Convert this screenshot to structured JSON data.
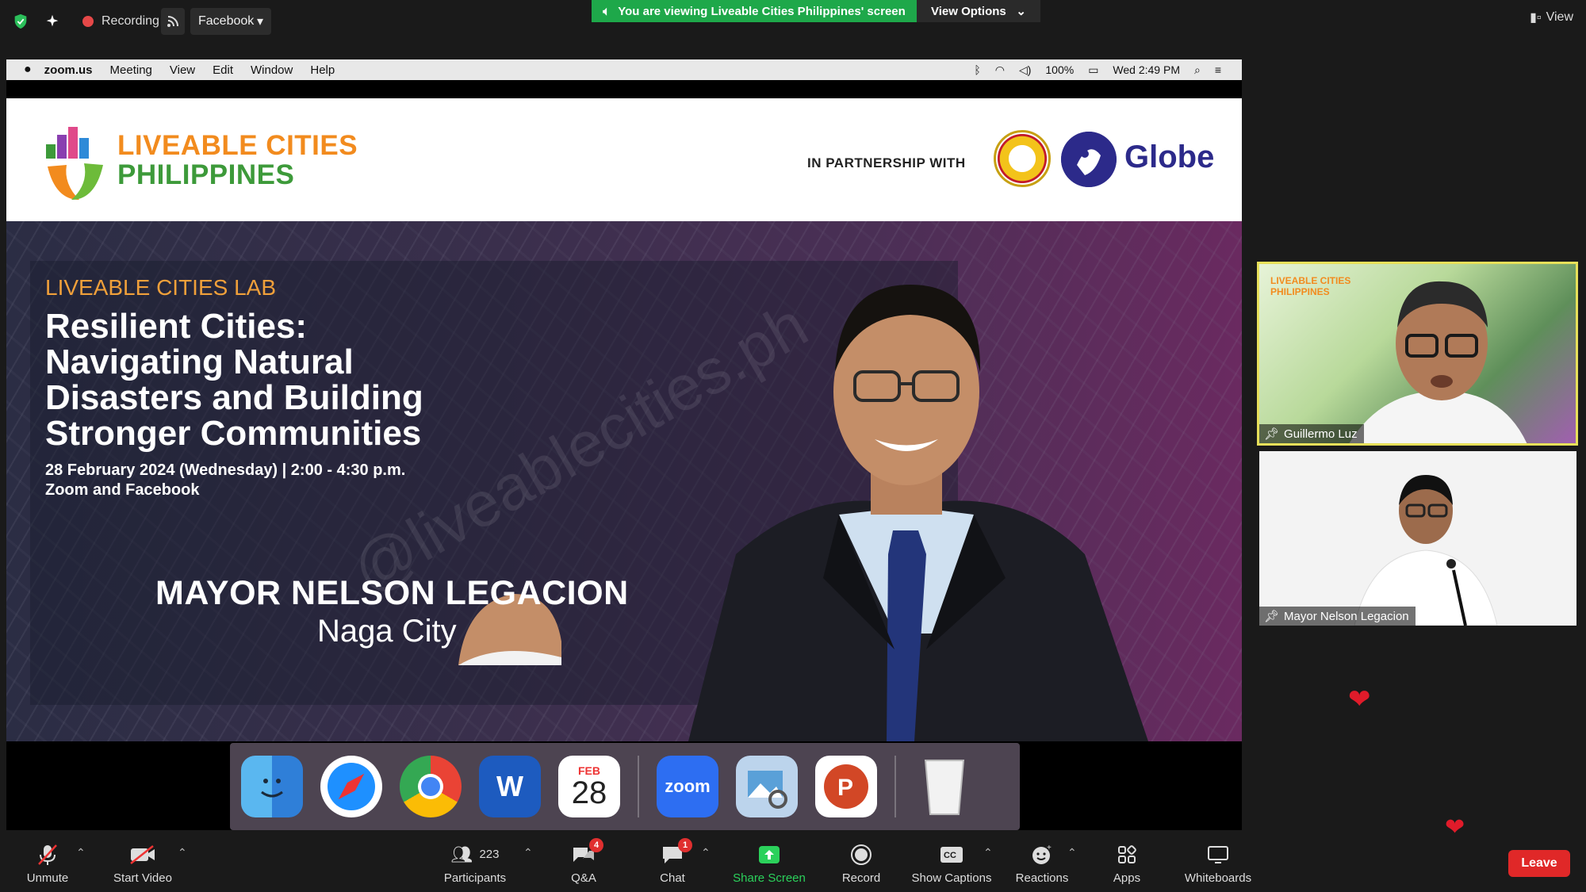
{
  "topbar": {
    "recording_label": "Recording",
    "stream_dropdown": "Facebook",
    "viewing_banner": "You are viewing Liveable Cities Philippines' screen",
    "view_options": "View Options",
    "view_label": "View"
  },
  "mac_menubar": {
    "app": "zoom.us",
    "menus": [
      "Meeting",
      "View",
      "Edit",
      "Window",
      "Help"
    ],
    "battery": "100%",
    "clock": "Wed 2:49 PM"
  },
  "slide": {
    "brand_line1": "LIVEABLE CITIES",
    "brand_line2": "PHILIPPINES",
    "partnership": "IN PARTNERSHIP WITH",
    "partner_brand": "Globe",
    "lab_label": "LIVEABLE CITIES LAB",
    "headline": "Resilient Cities: Navigating Natural Disasters and Building Stronger Communities",
    "date_line": "28 February 2024 (Wednesday) | 2:00 - 4:30 p.m.",
    "platform_line": "Zoom and Facebook",
    "speaker_name": "MAYOR NELSON LEGACION",
    "speaker_city": "Naga City",
    "watermark": "@liveablecities.ph"
  },
  "dock": {
    "calendar_month": "FEB",
    "calendar_day": "28",
    "zoom_label": "zoom"
  },
  "participants_tiles": [
    {
      "name": "Guillermo Luz",
      "tile_brand": "LIVEABLE CITIES PHILIPPINES"
    },
    {
      "name": "Mayor Nelson Legacion"
    }
  ],
  "toolbar": {
    "unmute": "Unmute",
    "start_video": "Start Video",
    "participants": "Participants",
    "participants_count": "223",
    "qa": "Q&A",
    "qa_badge": "4",
    "chat": "Chat",
    "chat_badge": "1",
    "share_screen": "Share Screen",
    "record": "Record",
    "show_captions": "Show Captions",
    "reactions": "Reactions",
    "apps": "Apps",
    "whiteboards": "Whiteboards",
    "leave": "Leave"
  },
  "colors": {
    "banner_green": "#1ea84a",
    "leave_red": "#e02828",
    "share_green": "#2bd15b",
    "brand_orange": "#f28b1e",
    "brand_green": "#3d9a3a",
    "globe_blue": "#2c2a8a"
  }
}
